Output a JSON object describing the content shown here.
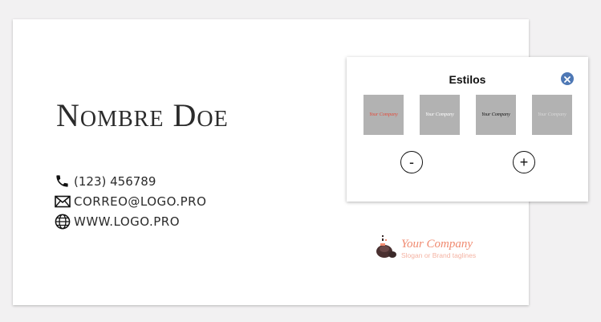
{
  "card": {
    "name": "Nombre Doe",
    "phone": "(123) 456789",
    "email": "CORREO@LOGO.PRO",
    "website": "WWW.LOGO.PRO",
    "logo": {
      "company": "Your Company",
      "slogan": "Slogan or Brand taglines",
      "company_color": "#f08a70"
    }
  },
  "styles_panel": {
    "title": "Estilos",
    "thumbnails": [
      {
        "label": "Your Company",
        "style": "red-text"
      },
      {
        "label": "Your Company",
        "style": "white-text"
      },
      {
        "label": "Your Company",
        "style": "dark-text"
      },
      {
        "label": "Your Company",
        "style": "light-text"
      }
    ],
    "decrease_label": "-",
    "increase_label": "+",
    "close_icon": "close-icon",
    "accent_color": "#4e78b5"
  }
}
